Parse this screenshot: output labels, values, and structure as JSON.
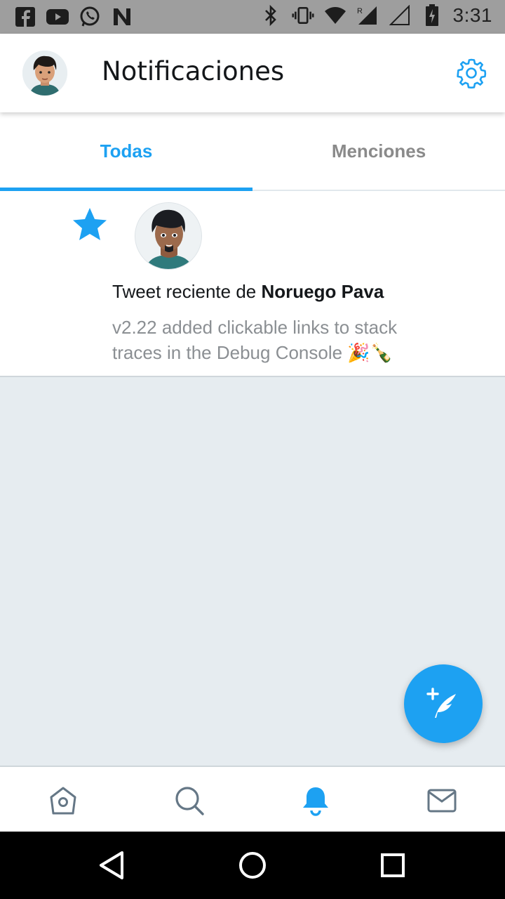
{
  "status_bar": {
    "time": "3:31",
    "left_icons": [
      "facebook-icon",
      "youtube-icon",
      "whatsapp-icon",
      "n-app-icon"
    ],
    "right_icons": [
      "bluetooth-icon",
      "vibrate-icon",
      "wifi-icon",
      "signal-roaming-icon",
      "signal-empty-icon",
      "battery-charging-icon"
    ]
  },
  "header": {
    "title": "Notificaciones",
    "settings_icon": "gear-icon"
  },
  "tabs": [
    {
      "label": "Todas",
      "active": true
    },
    {
      "label": "Menciones",
      "active": false
    }
  ],
  "notification": {
    "prefix": "Tweet reciente de ",
    "user": "Noruego Pava",
    "text": "v2.22 added clickable links to stack traces in the Debug Console 🎉🍾",
    "icon": "star-icon"
  },
  "bottom_nav": {
    "items": [
      "home-icon",
      "search-icon",
      "bell-icon",
      "mail-icon"
    ],
    "active": "bell-icon"
  },
  "colors": {
    "accent": "#1da1f2",
    "background": "#e6ecf0",
    "muted_text": "#8b8f93",
    "title_text": "#14171a"
  }
}
